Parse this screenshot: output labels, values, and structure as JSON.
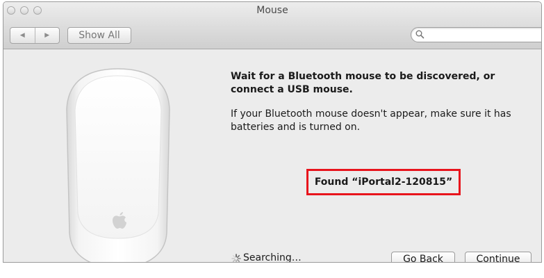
{
  "window": {
    "title": "Mouse"
  },
  "toolbar": {
    "back_glyph": "◀",
    "forward_glyph": "▶",
    "show_all_label": "Show All",
    "search_placeholder": "",
    "search_value": ""
  },
  "content": {
    "heading": "Wait for a Bluetooth mouse to be discovered, or connect a USB mouse.",
    "description": "If your Bluetooth mouse doesn't appear, make sure it has batteries and is turned on.",
    "found_text": "Found “iPortal2-120815”",
    "searching_text": "Searching…",
    "highlight_color": "#e8141c"
  },
  "buttons": {
    "go_back_label": "Go Back",
    "continue_label": "Continue"
  },
  "icons": {
    "mouse": "magic-mouse-icon",
    "apple": "apple-logo-icon",
    "spinner": "spinner-icon",
    "search": "search-icon"
  }
}
